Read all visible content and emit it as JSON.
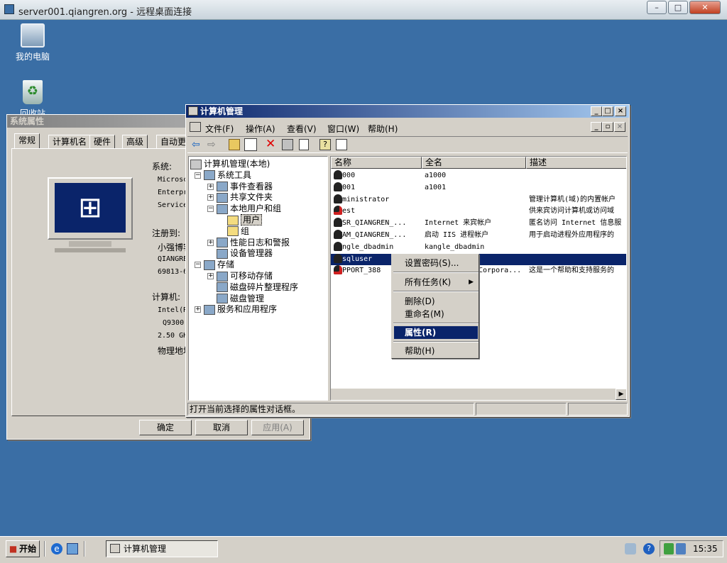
{
  "rdp": {
    "title": "server001.qiangren.org - 远程桌面连接",
    "min": "–",
    "max": "□",
    "close": "✕"
  },
  "desktop": {
    "my_computer": "我的电脑",
    "recycle_bin": "回收站"
  },
  "sysprops": {
    "title": "系统属性",
    "tabs": [
      "常规",
      "计算机名",
      "硬件",
      "高级",
      "自动更"
    ],
    "system_label": "系统:",
    "system_lines": [
      "Microsc",
      "Enterpr",
      "Service"
    ],
    "registered_label": "注册到:",
    "registered_lines": [
      "小强博客",
      "QIANGRE",
      "69813-6"
    ],
    "computer_label": "计算机:",
    "computer_lines": [
      "Intel(R",
      "Q9300",
      "2.50 GH",
      "物理地址"
    ],
    "ok": "确定",
    "cancel": "取消",
    "apply": "应用(A)"
  },
  "mmc": {
    "title": "计算机管理",
    "menus": [
      "文件(F)",
      "操作(A)",
      "查看(V)",
      "窗口(W)",
      "帮助(H)"
    ],
    "tree": [
      {
        "label": "计算机管理(本地)",
        "indent": 0,
        "pm": ""
      },
      {
        "label": "系统工具",
        "indent": 1,
        "pm": "−"
      },
      {
        "label": "事件查看器",
        "indent": 2,
        "pm": "+"
      },
      {
        "label": "共享文件夹",
        "indent": 2,
        "pm": "+"
      },
      {
        "label": "本地用户和组",
        "indent": 2,
        "pm": "−"
      },
      {
        "label": "用户",
        "indent": 3,
        "pm": ""
      },
      {
        "label": "组",
        "indent": 3,
        "pm": ""
      },
      {
        "label": "性能日志和警报",
        "indent": 2,
        "pm": "+"
      },
      {
        "label": "设备管理器",
        "indent": 2,
        "pm": ""
      },
      {
        "label": "存储",
        "indent": 1,
        "pm": "−"
      },
      {
        "label": "可移动存储",
        "indent": 2,
        "pm": "+"
      },
      {
        "label": "磁盘碎片整理程序",
        "indent": 2,
        "pm": ""
      },
      {
        "label": "磁盘管理",
        "indent": 2,
        "pm": ""
      },
      {
        "label": "服务和应用程序",
        "indent": 1,
        "pm": "+"
      }
    ],
    "columns": [
      "名称",
      "全名",
      "描述"
    ],
    "users": [
      {
        "name": "a1000",
        "full": "a1000",
        "desc": ""
      },
      {
        "name": "a1001",
        "full": "a1001",
        "desc": ""
      },
      {
        "name": "Administrator",
        "full": "",
        "desc": "管理计算机(域)的内置帐户"
      },
      {
        "name": "Guest",
        "full": "",
        "desc": "供来宾访问计算机或访问域"
      },
      {
        "name": "IUSR_QIANGREN_...",
        "full": "Internet 来宾帐户",
        "desc": "匿名访问 Internet 信息服"
      },
      {
        "name": "IWAM_QIANGREN_...",
        "full": "启动 IIS 进程帐户",
        "desc": "用于启动进程外应用程序的"
      },
      {
        "name": "kangle_dbadmin",
        "full": "kangle_dbadmin",
        "desc": ""
      },
      {
        "name": "mysqluser",
        "full": "",
        "desc": ""
      },
      {
        "name": "SUPPORT_388",
        "full": "Corpora...",
        "desc": "这是一个帮助和支持服务的"
      }
    ],
    "status": "打开当前选择的属性对话框。"
  },
  "context_menu": {
    "set_password": "设置密码(S)...",
    "all_tasks": "所有任务(K)",
    "delete": "删除(D)",
    "rename": "重命名(M)",
    "properties": "属性(R)",
    "help": "帮助(H)"
  },
  "taskbar": {
    "start": "开始",
    "task": "计算机管理",
    "clock": "15:35"
  }
}
